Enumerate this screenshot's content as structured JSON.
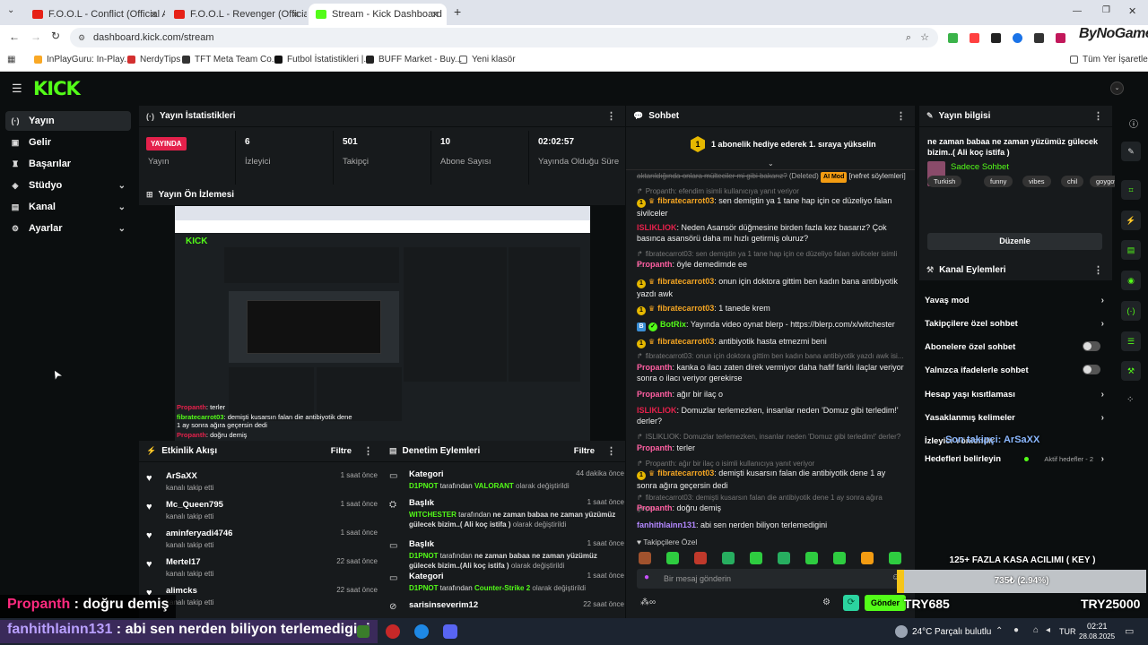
{
  "browser": {
    "tabs": [
      {
        "title": "F.O.O.L - Conflict (Official Audi",
        "active": false
      },
      {
        "title": "F.O.O.L - Revenger (Official Audi",
        "active": false
      },
      {
        "title": "Stream - Kick Dashboard",
        "active": true
      }
    ],
    "new_tab": "+",
    "url": "dashboard.kick.com/stream",
    "bookmarks": [
      "InPlayGuru: In-Play...",
      "NerdyTips",
      "TFT Meta Team Co...",
      "Futbol İstatistikleri |...",
      "BUFF Market - Buy...",
      "Yeni klasör"
    ],
    "bookmarks_right": "Tüm Yer İşaretleri",
    "watermark": "ByNoGame"
  },
  "kick": {
    "logo": "KICK",
    "sidebar": [
      {
        "label": "Yayın",
        "icon": "broadcast-icon",
        "active": true,
        "expand": false
      },
      {
        "label": "Gelir",
        "icon": "wallet-icon",
        "active": false,
        "expand": false
      },
      {
        "label": "Başarılar",
        "icon": "trophy-icon",
        "active": false,
        "expand": false
      },
      {
        "label": "Stüdyo",
        "icon": "studio-icon",
        "active": false,
        "expand": true
      },
      {
        "label": "Kanal",
        "icon": "channel-icon",
        "active": false,
        "expand": true
      },
      {
        "label": "Ayarlar",
        "icon": "gear-icon",
        "active": false,
        "expand": true
      }
    ],
    "stats": {
      "title": "Yayın İstatistikleri",
      "items": [
        {
          "value": "YAYINDA",
          "label": "Yayın"
        },
        {
          "value": "6",
          "label": "İzleyici"
        },
        {
          "value": "501",
          "label": "Takipçi"
        },
        {
          "value": "10",
          "label": "Abone Sayısı"
        },
        {
          "value": "02:02:57",
          "label": "Yayında Olduğu Süre"
        }
      ]
    },
    "preview_title": "Yayın Ön İzlemesi",
    "preview_overlay": {
      "line1_user": "Propanth",
      "line1_msg": ": terler",
      "line2_user": "fibratecarrot03",
      "line2_msg": ": demişti kusarsın falan die antibiyotik dene 1 ay sonra ağıra geçersin dedi",
      "line3_user": "Propanth",
      "line3_msg": ": doğru demiş"
    },
    "activity": {
      "title": "Etkinlik Akışı",
      "filter": "Filtre",
      "items": [
        {
          "name": "ArSaXX",
          "sub": "kanalı takip etti",
          "time": "1 saat önce"
        },
        {
          "name": "Mc_Queen795",
          "sub": "kanalı takip etti",
          "time": "1 saat önce"
        },
        {
          "name": "aminferyadi4746",
          "sub": "kanalı takip etti",
          "time": "1 saat önce"
        },
        {
          "name": "Mertel17",
          "sub": "kanalı takip etti",
          "time": "22 saat önce"
        },
        {
          "name": "alimcks",
          "sub": "kanalı takip etti",
          "time": "22 saat önce"
        }
      ]
    },
    "moderation": {
      "title": "Denetim Eylemleri",
      "filter": "Filtre",
      "items": [
        {
          "name": "Kategori",
          "time": "44 dakika önce",
          "actor": "D1PNOT",
          "mid": " tarafından ",
          "value": "VALORANT",
          "end": " olarak değiştirildi"
        },
        {
          "name": "Başlık",
          "time": "1 saat önce",
          "actor": "WITCHESTER",
          "mid": " tarafından ",
          "value": "ne zaman babaa ne zaman yüzümüz gülecek bizim..( Ali koç istifa )",
          "end": " olarak değiştirildi"
        },
        {
          "name": "Başlık",
          "time": "1 saat önce",
          "actor": "D1PNOT",
          "mid": " tarafından ",
          "value": "ne zaman babaa ne zaman yüzümüz gülecek bizim..(Ali koç istifa )",
          "end": " olarak değiştirildi"
        },
        {
          "name": "Kategori",
          "time": "1 saat önce",
          "actor": "D1PNOT",
          "mid": " tarafından ",
          "value": "Counter-Strike 2",
          "end": " olarak değiştirildi"
        },
        {
          "name": "sarisinseverim12",
          "time": "22 saat önce",
          "actor": "",
          "mid": "",
          "value": "",
          "end": ""
        }
      ]
    },
    "chat": {
      "title": "Sohbet",
      "pinned": "1 abonelik hediye ederek 1. sıraya yükselin",
      "placeholder": "Bir mesaj gönderin",
      "send": "Gönder",
      "followers_only": "Takipçilere Özel",
      "deleted_tag": "(Deleted)",
      "ai_mod_tag": "AI Mod",
      "hate_tag": "[nefret söylemleri]",
      "deleted_msg": "aktarıldığında onlara mülteciler mi gibi bakarız?",
      "messages": [
        {
          "user": "",
          "text": "Propanth: efendim isimli kullanıcıya yanıt veriyor",
          "dim": true
        },
        {
          "user": "fibratecarrot03",
          "text": ": sen demiştin ya 1 tane hap için ce düzeliyo falan sivilceler"
        },
        {
          "user": "ISLIKLIOK",
          "text": ": Neden Asansör düğmesine birden fazla kez basarız? Çok basınca asansörü daha mı hızlı getirmiş oluruz?"
        },
        {
          "user": "",
          "text": "fibratecarrot03: sen demiştin ya 1 tane hap için ce düzeliyo falan sivilceler isimli k...",
          "dim": true
        },
        {
          "user": "Propanth",
          "text": ": öyle demedimde ee"
        },
        {
          "user": "fibratecarrot03",
          "text": ": onun için doktora gittim ben kadın bana antibiyotik yazdı awk"
        },
        {
          "user": "fibratecarrot03",
          "text": ": 1 tanede krem"
        },
        {
          "user": "BotRix",
          "text": ": Yayında video oynat blerp - https://blerp.com/x/witchester"
        },
        {
          "user": "fibratecarrot03",
          "text": ": antibiyotik hasta etmezmi beni"
        },
        {
          "user": "",
          "text": "fibratecarrot03: onun için doktora gittim ben kadın bana antibiyotik yazdı awk isi...",
          "dim": true
        },
        {
          "user": "Propanth",
          "text": ": kanka o ilacı zaten direk vermiyor daha hafif farklı ilaçlar veriyor sonra o ilacı veriyor gerekirse"
        },
        {
          "user": "Propanth",
          "text": ": ağır bir ilaç o"
        },
        {
          "user": "ISLIKLIOK",
          "text": ": Domuzlar terlemezken, insanlar neden 'Domuz gibi terledim!' derler?"
        },
        {
          "user": "",
          "text": "ISLIKLIOK: Domuzlar terlemezken, insanlar neden 'Domuz gibi terledim!' derler? i...",
          "dim": true
        },
        {
          "user": "Propanth",
          "text": ": terler"
        },
        {
          "user": "",
          "text": "Propanth: ağır bir ilaç o isimli kullanıcıya yanıt veriyor",
          "dim": true
        },
        {
          "user": "fibratecarrot03",
          "text": ": demişti kusarsın falan die antibiyotik dene 1 ay sonra ağıra geçersin dedi"
        },
        {
          "user": "",
          "text": "fibratecarrot03: demişti kusarsın falan die antibiyotik dene 1 ay sonra ağıra geçer...",
          "dim": true
        },
        {
          "user": "Propanth",
          "text": ": doğru demiş"
        },
        {
          "user": "fanhithlainn131",
          "text": ": abi sen nerden biliyon terlemedigini"
        }
      ]
    },
    "stream_info": {
      "title": "Yayın bilgisi",
      "stream_title": "ne zaman babaa ne zaman yüzümüz gülecek bizim..( Ali koç istifa )",
      "category": "Sadece Sohbet",
      "tags": [
        "Turkish",
        "funny",
        "vibes",
        "chil",
        "goygoy"
      ],
      "edit": "Düzenle"
    },
    "channel_actions": {
      "title": "Kanal Eylemleri",
      "items": [
        {
          "label": "Yavaş mod",
          "type": "chevron"
        },
        {
          "label": "Takipçilere özel sohbet",
          "type": "chevron"
        },
        {
          "label": "Abonelere özel sohbet",
          "type": "toggle"
        },
        {
          "label": "Yalnızca ifadelerle sohbet",
          "type": "toggle"
        },
        {
          "label": "Hesap yaşı kısıtlaması",
          "type": "chevron"
        },
        {
          "label": "Yasaklanmış kelimeler",
          "type": "chevron"
        },
        {
          "label": "İzleyici Yönlendir",
          "type": "none"
        },
        {
          "label": "Hedefleri belirleyin",
          "type": "chevron"
        }
      ],
      "goals_status": "Aktif hedefler - 2"
    }
  },
  "overlays": {
    "last_follower": "Son takipçi: ArSaXX",
    "case_title": "125+ FAZLA KASA ACILIMI ( KEY )",
    "case_value": "735₺ (2.94%)",
    "case_progress": 0.0294,
    "try_left": "TRY685",
    "try_right": "TRY25000",
    "bottom_chat1_user": "Propanth",
    "bottom_chat1_msg": " : doğru demiş",
    "bottom_chat2_user": "fanhithlainn131",
    "bottom_chat2_msg": " : abi sen nerden biliyon terlemedigini"
  },
  "taskbar": {
    "weather": "24°C",
    "weather_desc": "Parçalı bulutlu",
    "lang": "TUR",
    "time": "02:21",
    "date": "28.08.2025"
  },
  "colors": {
    "kick_green": "#53fc18",
    "live_red": "#e4214b",
    "panel": "#171a1c"
  }
}
